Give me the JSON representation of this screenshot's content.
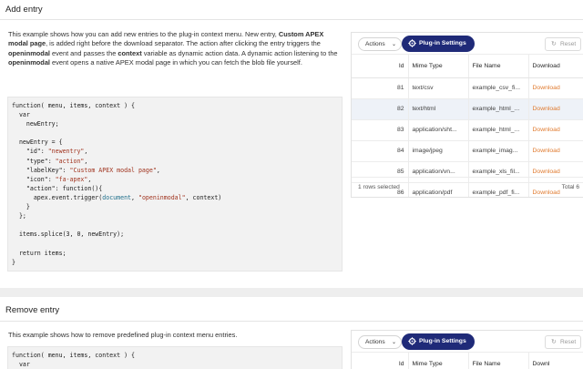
{
  "add_entry": {
    "title": "Add entry",
    "desc": {
      "p1": "This example shows how you can add new entries to the plug-in context menu. New entry, ",
      "b1": "Custom APEX modal page",
      "p2": ", is added right before the download separator. The action after clicking the entry triggers the ",
      "b2": "openinmodal",
      "p3": " event and passes the ",
      "b3": "context",
      "p4": " variable as dynamic action data. A dynamic action listening to the ",
      "b4": "openinmodal",
      "p5": " event opens a native APEX modal page in which you can fetch the blob file yourself."
    },
    "code": {
      "l1": "function( menu, items, context ) {",
      "l2": "  var",
      "l3": "    newEntry;",
      "l5": "  newEntry = {",
      "k_id": "    \"id\": ",
      "v_id": "\"newentry\"",
      "k_type": "    \"type\": ",
      "v_type": "\"action\"",
      "k_label": "    \"labelKey\": ",
      "v_label": "\"Custom APEX modal page\"",
      "k_icon": "    \"icon\": ",
      "v_icon": "\"fa-apex\"",
      "k_action": "    \"action\": ",
      "v_action": "function(){",
      "l11a": "      apex.event.trigger(",
      "l11b": "document",
      "l11c": ", ",
      "l11d": "\"openinmodal\"",
      "l11e": ", context)",
      "l12": "    }",
      "l13": "  };",
      "l15": "  items.splice(3, 0, newEntry);",
      "l17": "  return items;",
      "l18": "}"
    },
    "grid": {
      "actions_label": "Actions",
      "plugin_label": "Plug-in Settings",
      "reset_label": "Reset",
      "columns": [
        "Id",
        "Mime Type",
        "File Name",
        "Download"
      ],
      "rows": [
        {
          "id": "81",
          "mime": "text/csv",
          "file": "example_csv_fi...",
          "dl": "Download"
        },
        {
          "id": "82",
          "mime": "text/html",
          "file": "example_html_...",
          "dl": "Download"
        },
        {
          "id": "83",
          "mime": "application/sht...",
          "file": "example_html_...",
          "dl": "Download"
        },
        {
          "id": "84",
          "mime": "image/jpeg",
          "file": "example_imag...",
          "dl": "Download"
        },
        {
          "id": "85",
          "mime": "application/vn...",
          "file": "example_xls_fil...",
          "dl": "Download"
        },
        {
          "id": "86",
          "mime": "application/pdf",
          "file": "example_pdf_fi...",
          "dl": "Download"
        }
      ],
      "selected_row": 1,
      "footer_left": "1 rows selected",
      "footer_right": "Total 6"
    }
  },
  "remove_entry": {
    "title": "Remove entry",
    "desc": "This example shows how to remove predefined plug-in context menu entries.",
    "code": {
      "l1": "function( menu, items, context ) {",
      "l2": "  var"
    },
    "grid": {
      "actions_label": "Actions",
      "plugin_label": "Plug-in Settings",
      "reset_label": "Reset",
      "columns": [
        "Id",
        "Mime Type",
        "File Name",
        "Downl"
      ]
    }
  },
  "colors": {
    "plugin_button": "#1f2a78",
    "download_link": "#e07a2e",
    "selected_row": "#eef2f8",
    "code_string": "#a0331e"
  }
}
